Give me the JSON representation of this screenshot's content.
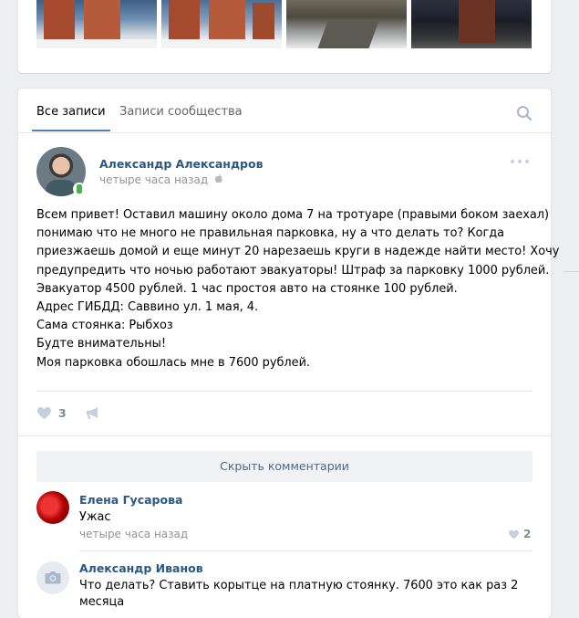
{
  "tabs": {
    "all_posts": "Все записи",
    "community_posts": "Записи сообщества"
  },
  "post": {
    "author": "Александр Александров",
    "time": "четыре часа назад",
    "lines": [
      "Всем привет! Оставил машину около дома 7 на тротуаре (правыми боком заехал)",
      "понимаю что не много не правильная парковка, ну а что делать то? Когда",
      "приезжаешь домой и еще минут 20 нарезаешь круги в надежде найти место! Хочу",
      "предупредить что ночью работают эвакуаторы! Штраф за парковку 1000 рублей.",
      "Эвакуатор 4500 рублей. 1 час простоя авто на стоянке 100 рублей.",
      "Адрес ГИБДД: Саввино ул. 1 мая, 4.",
      "Сама стоянка: Рыбхоз",
      "Будте внимательны!",
      "Моя парковка обошлась мне в 7600 рублей."
    ],
    "likes": "3"
  },
  "comments_toggle": "Скрыть комментарии",
  "comments": [
    {
      "author": "Елена Гусарова",
      "text": "Ужас",
      "time": "четыре часа назад",
      "likes": "2"
    },
    {
      "author": "Александр Иванов",
      "text": "Что делать? Ставить корытце на платную стоянку. 7600 это как раз 2",
      "text_cont": "месяца"
    }
  ],
  "icons": {
    "search": "search-icon",
    "more": "more-icon",
    "like": "heart-icon",
    "share": "megaphone-icon",
    "platform": "apple-icon",
    "mobile": "mobile-badge-icon",
    "camera": "camera-icon"
  },
  "colors": {
    "accent": "#5181b8",
    "link": "#2a5885",
    "muted": "#939393",
    "icon": "#c5d0db"
  }
}
